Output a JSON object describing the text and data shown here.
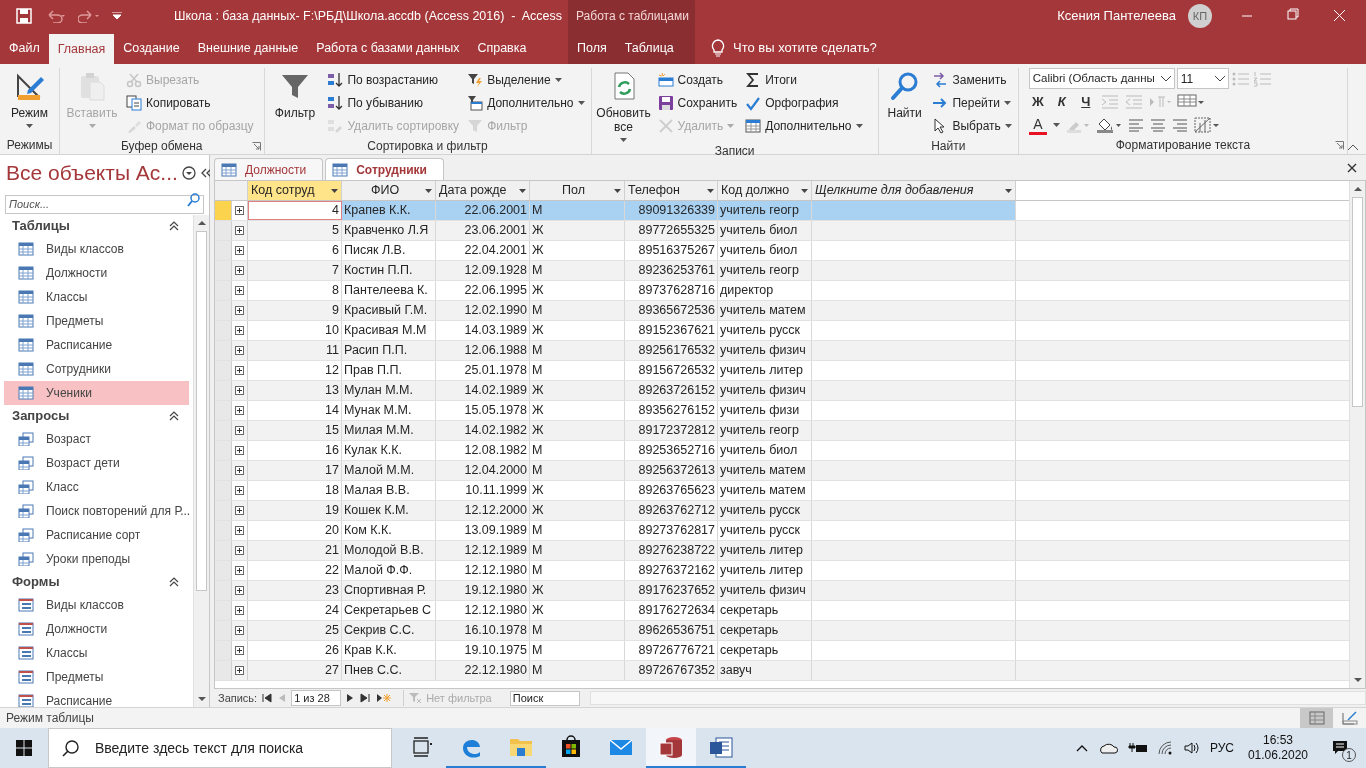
{
  "title_bar": {
    "title": "Школа : база данных- F:\\РБД\\Школа.accdb (Access 2016)  -  Access",
    "context_group": "Работа с таблицами",
    "user": "Ксения Пантелеева",
    "avatar": "КП"
  },
  "ribbon_tabs": [
    {
      "label": "Файл",
      "kind": "main",
      "selected": false
    },
    {
      "label": "Главная",
      "kind": "main",
      "selected": true
    },
    {
      "label": "Создание",
      "kind": "main",
      "selected": false
    },
    {
      "label": "Внешние данные",
      "kind": "main",
      "selected": false
    },
    {
      "label": "Работа с базами данных",
      "kind": "main",
      "selected": false
    },
    {
      "label": "Справка",
      "kind": "main",
      "selected": false
    },
    {
      "label": "Поля",
      "kind": "context",
      "selected": false
    },
    {
      "label": "Таблица",
      "kind": "context",
      "selected": false
    }
  ],
  "tell_me": "Что вы хотите сделать?",
  "ribbon_groups": [
    {
      "title": "Режимы",
      "launcher": false,
      "items": [
        {
          "kind": "large",
          "label": "Режим",
          "disabled": false,
          "dropdown": true
        }
      ]
    },
    {
      "title": "Буфер обмена",
      "launcher": true,
      "items": [
        {
          "kind": "large",
          "label": "Вставить",
          "disabled": true,
          "dropdown": true
        },
        {
          "kind": "small",
          "label": "Вырезать",
          "disabled": true,
          "dropdown": false
        },
        {
          "kind": "small",
          "label": "Копировать",
          "disabled": false,
          "dropdown": false
        },
        {
          "kind": "small",
          "label": "Формат по образцу",
          "disabled": true,
          "dropdown": false
        }
      ]
    },
    {
      "title": "Сортировка и фильтр",
      "launcher": false,
      "items": [
        {
          "kind": "large",
          "label": "Фильтр",
          "disabled": false,
          "dropdown": false
        },
        {
          "kind": "small",
          "label": "По возрастанию",
          "disabled": false,
          "dropdown": false
        },
        {
          "kind": "small",
          "label": "По убыванию",
          "disabled": false,
          "dropdown": false
        },
        {
          "kind": "small",
          "label": "Удалить сортировку",
          "disabled": true,
          "dropdown": false
        },
        {
          "kind": "small",
          "label": "Выделение",
          "disabled": false,
          "dropdown": true
        },
        {
          "kind": "small",
          "label": "Дополнительно",
          "disabled": false,
          "dropdown": true
        },
        {
          "kind": "small",
          "label": "Фильтр",
          "disabled": true,
          "dropdown": false
        }
      ]
    },
    {
      "title": "Записи",
      "launcher": false,
      "items": [
        {
          "kind": "large",
          "label": "Обновить все",
          "disabled": false,
          "dropdown": true
        },
        {
          "kind": "small",
          "label": "Создать",
          "disabled": false,
          "dropdown": false
        },
        {
          "kind": "small",
          "label": "Сохранить",
          "disabled": false,
          "dropdown": false
        },
        {
          "kind": "small",
          "label": "Удалить",
          "disabled": true,
          "dropdown": true
        },
        {
          "kind": "small",
          "label": "Итоги",
          "disabled": false,
          "dropdown": false
        },
        {
          "kind": "small",
          "label": "Орфография",
          "disabled": false,
          "dropdown": false
        },
        {
          "kind": "small",
          "label": "Дополнительно",
          "disabled": false,
          "dropdown": true
        }
      ]
    },
    {
      "title": "Найти",
      "launcher": false,
      "items": [
        {
          "kind": "large",
          "label": "Найти",
          "disabled": false,
          "dropdown": false
        },
        {
          "kind": "small",
          "label": "Заменить",
          "disabled": false,
          "dropdown": false
        },
        {
          "kind": "small",
          "label": "Перейти",
          "disabled": false,
          "dropdown": true
        },
        {
          "kind": "small",
          "label": "Выбрать",
          "disabled": false,
          "dropdown": true
        }
      ]
    }
  ],
  "text_format": {
    "title": "Форматирование текста",
    "launcher": true,
    "font": "Calibri (Область данны",
    "size": "11",
    "style_buttons": [
      {
        "kind": "bold",
        "label": "Ж"
      },
      {
        "kind": "italic",
        "label": "К"
      },
      {
        "kind": "underline",
        "label": "Ч"
      }
    ],
    "font_color_label": "A"
  },
  "nav_pane": {
    "title": "Все объекты Ас...",
    "search_placeholder": "Поиск...",
    "sections": [
      {
        "title": "Таблицы",
        "kind": "table",
        "items": [
          {
            "label": "Виды классов",
            "selected": false
          },
          {
            "label": "Должности",
            "selected": false
          },
          {
            "label": "Классы",
            "selected": false
          },
          {
            "label": "Предметы",
            "selected": false
          },
          {
            "label": "Расписание",
            "selected": false
          },
          {
            "label": "Сотрудники",
            "selected": false
          },
          {
            "label": "Ученики",
            "selected": true
          }
        ]
      },
      {
        "title": "Запросы",
        "kind": "query",
        "items": [
          {
            "label": "Возраст",
            "selected": false
          },
          {
            "label": "Возраст дети",
            "selected": false
          },
          {
            "label": "Класс",
            "selected": false
          },
          {
            "label": "Поиск повторений для Р...",
            "selected": false
          },
          {
            "label": "Расписание сорт",
            "selected": false
          },
          {
            "label": "Уроки преподы",
            "selected": false
          }
        ]
      },
      {
        "title": "Формы",
        "kind": "form",
        "items": [
          {
            "label": "Виды классов",
            "selected": false
          },
          {
            "label": "Должности",
            "selected": false
          },
          {
            "label": "Классы",
            "selected": false
          },
          {
            "label": "Предметы",
            "selected": false
          },
          {
            "label": "Расписание",
            "selected": false
          }
        ]
      }
    ]
  },
  "document_tabs": [
    {
      "label": "Должности",
      "selected": false
    },
    {
      "label": "Сотрудники",
      "selected": true
    }
  ],
  "datasheet": {
    "columns": [
      {
        "label": "Код сотруд",
        "kind": "number",
        "active": true
      },
      {
        "label": "ФИО",
        "kind": "text",
        "active": false
      },
      {
        "label": "Дата рожде",
        "kind": "number",
        "active": false
      },
      {
        "label": "Пол",
        "kind": "text",
        "active": false
      },
      {
        "label": "Телефон",
        "kind": "number",
        "active": false
      },
      {
        "label": "Код должно",
        "kind": "text",
        "active": false
      },
      {
        "label": "Щелкните для добавления",
        "kind": "add",
        "active": false
      }
    ],
    "rows": [
      {
        "selected": true,
        "cells": [
          "4",
          "Крапев К.К.",
          "22.06.2001",
          "М",
          "89091326339",
          "учитель геогр"
        ]
      },
      {
        "selected": false,
        "cells": [
          "5",
          "Кравченко Л.Я",
          "23.06.2001",
          "Ж",
          "89772655325",
          "учитель биол"
        ]
      },
      {
        "selected": false,
        "cells": [
          "6",
          "Писяк Л.В.",
          "22.04.2001",
          "Ж",
          "89516375267",
          "учитель биол"
        ]
      },
      {
        "selected": false,
        "cells": [
          "7",
          "Костин П.П.",
          "12.09.1928",
          "М",
          "89236253761",
          "учитель геогр"
        ]
      },
      {
        "selected": false,
        "cells": [
          "8",
          "Пантелеева К.",
          "22.06.1995",
          "Ж",
          "89737628716",
          "директор"
        ]
      },
      {
        "selected": false,
        "cells": [
          "9",
          "Красивый Г.М.",
          "12.02.1990",
          "М",
          "89365672536",
          "учитель матем"
        ]
      },
      {
        "selected": false,
        "cells": [
          "10",
          "Красивая М.М",
          "14.03.1989",
          "Ж",
          "89152367621",
          "учитель русск"
        ]
      },
      {
        "selected": false,
        "cells": [
          "11",
          "Расип П.П.",
          "12.06.1988",
          "М",
          "89256176532",
          "учитель физич"
        ]
      },
      {
        "selected": false,
        "cells": [
          "12",
          "Прав П.П.",
          "25.01.1978",
          "М",
          "89156726532",
          "учитель литер"
        ]
      },
      {
        "selected": false,
        "cells": [
          "13",
          "Мулан М.М.",
          "14.02.1989",
          "Ж",
          "89263726152",
          "учитель физич"
        ]
      },
      {
        "selected": false,
        "cells": [
          "14",
          "Мунак М.М.",
          "15.05.1978",
          "Ж",
          "89356276152",
          "учитель физи"
        ]
      },
      {
        "selected": false,
        "cells": [
          "15",
          "Милая М.М.",
          "14.02.1982",
          "Ж",
          "89172372812",
          "учитель геогр"
        ]
      },
      {
        "selected": false,
        "cells": [
          "16",
          "Кулак К.К.",
          "12.08.1982",
          "М",
          "89253652716",
          "учитель биол"
        ]
      },
      {
        "selected": false,
        "cells": [
          "17",
          "Малой М.М.",
          "12.04.2000",
          "М",
          "89256372613",
          "учитель матем"
        ]
      },
      {
        "selected": false,
        "cells": [
          "18",
          "Малая В.В.",
          "10.11.1999",
          "Ж",
          "89263765623",
          "учитель матем"
        ]
      },
      {
        "selected": false,
        "cells": [
          "19",
          "Кошек К.М.",
          "12.12.2000",
          "Ж",
          "89263762712",
          "учитель русск"
        ]
      },
      {
        "selected": false,
        "cells": [
          "20",
          "Ком К.К.",
          "13.09.1989",
          "М",
          "89273762817",
          "учитель русск"
        ]
      },
      {
        "selected": false,
        "cells": [
          "21",
          "Молодой В.В.",
          "12.12.1989",
          "М",
          "89276238722",
          "учитель литер"
        ]
      },
      {
        "selected": false,
        "cells": [
          "22",
          "Малой Ф.Ф.",
          "12.12.1980",
          "М",
          "89276372162",
          "учитель литер"
        ]
      },
      {
        "selected": false,
        "cells": [
          "23",
          "Спортивная Р.",
          "19.12.1980",
          "Ж",
          "89176237652",
          "учитель физич"
        ]
      },
      {
        "selected": false,
        "cells": [
          "24",
          "Секретарьев С",
          "12.12.1980",
          "Ж",
          "89176272634",
          "секретарь"
        ]
      },
      {
        "selected": false,
        "cells": [
          "25",
          "Секрив С.С.",
          "16.10.1978",
          "М",
          "89626536751",
          "секретарь"
        ]
      },
      {
        "selected": false,
        "cells": [
          "26",
          "Крав К.К.",
          "19.10.1975",
          "М",
          "89726776721",
          "секретарь"
        ]
      },
      {
        "selected": false,
        "cells": [
          "27",
          "Пнев С.С.",
          "22.12.1980",
          "М",
          "89726767352",
          "завуч"
        ]
      }
    ]
  },
  "record_nav": {
    "label": "Запись:",
    "position": "1 из 28",
    "filter": "Нет фильтра",
    "search_placeholder": "Поиск"
  },
  "status_bar": {
    "text": "Режим таблицы",
    "views": [
      {
        "kind": "datasheet",
        "selected": true
      },
      {
        "kind": "design",
        "selected": false
      }
    ]
  },
  "taskbar": {
    "search_placeholder": "Введите здесь текст для поиска",
    "apps": [
      {
        "kind": "taskview",
        "running": false,
        "active": false
      },
      {
        "kind": "edge",
        "running": true,
        "active": false
      },
      {
        "kind": "explorer",
        "running": true,
        "active": false
      },
      {
        "kind": "store",
        "running": false,
        "active": false
      },
      {
        "kind": "mail",
        "running": false,
        "active": false
      },
      {
        "kind": "access",
        "running": true,
        "active": true
      },
      {
        "kind": "word",
        "running": true,
        "active": false
      }
    ],
    "language": "РУС",
    "time": "16:53",
    "date": "01.06.2020",
    "notifications": "1"
  }
}
